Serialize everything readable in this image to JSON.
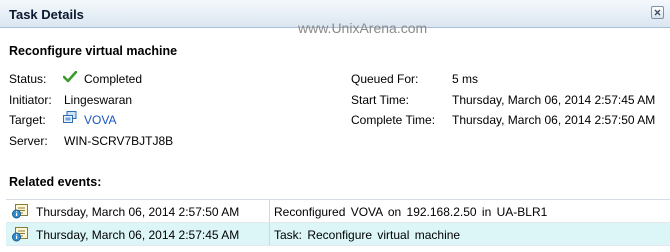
{
  "window": {
    "title": "Task Details",
    "watermark": "www.UnixArena.com"
  },
  "task": {
    "name": "Reconfigure virtual machine",
    "fields": {
      "status_label": "Status:",
      "status_value": "Completed",
      "initiator_label": "Initiator:",
      "initiator_value": "Lingeswaran",
      "target_label": "Target:",
      "target_value": "VOVA",
      "server_label": "Server:",
      "server_value": "WIN-SCRV7BJTJ8B",
      "queued_label": "Queued For:",
      "queued_value": "5 ms",
      "start_label": "Start Time:",
      "start_value": "Thursday, March 06, 2014 2:57:45 AM",
      "complete_label": "Complete Time:",
      "complete_value": "Thursday, March 06, 2014 2:57:50 AM"
    }
  },
  "related": {
    "title": "Related events:",
    "events": [
      {
        "time": "Thursday, March 06, 2014 2:57:50 AM",
        "description": "Reconfigured VOVA on 192.168.2.50 in UA-BLR1"
      },
      {
        "time": "Thursday, March 06, 2014 2:57:45 AM",
        "description": "Task: Reconfigure virtual machine"
      }
    ]
  },
  "icons": {
    "status": "checkmark-icon",
    "target": "virtual-machine-icon",
    "event": "event-info-icon",
    "close": "close-icon"
  },
  "colors": {
    "status_check": "#3a9a2a",
    "link": "#1a56c4",
    "selected_row": "#dcf6f8"
  }
}
